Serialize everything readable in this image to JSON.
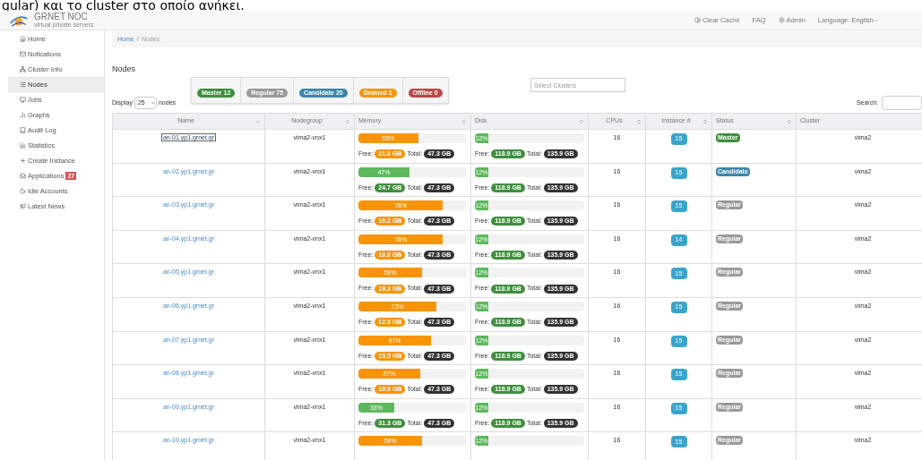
{
  "caption": "gular) και το cluster στο οποίο ανήκει.",
  "header": {
    "brand": "GRNET NOC",
    "tagline": "virtual private servers",
    "links": [
      {
        "kind": "cache",
        "label": "Clear Cache"
      },
      {
        "kind": "plain",
        "label": "FAQ"
      },
      {
        "kind": "admin",
        "label": "Admin"
      },
      {
        "kind": "dropdown",
        "label": "Language: English"
      }
    ]
  },
  "sidebar": {
    "items": [
      {
        "label": "Home",
        "selected": false
      },
      {
        "label": "Nofications",
        "selected": false
      },
      {
        "label": "Cluster Info",
        "selected": false
      },
      {
        "label": "Nodes",
        "selected": true
      },
      {
        "label": "Jobs",
        "selected": false
      },
      {
        "label": "Graphs",
        "selected": false
      },
      {
        "label": "Audit Log",
        "selected": false
      },
      {
        "label": "Statistics",
        "selected": false
      },
      {
        "label": "Create Instance",
        "selected": false
      },
      {
        "label": "Applications",
        "badge": "27",
        "selected": false
      },
      {
        "label": "Idle Accounts",
        "selected": false
      },
      {
        "label": "Latest News",
        "selected": false
      }
    ]
  },
  "breadcrumb": {
    "items": [
      "Home",
      "Nodes"
    ],
    "separator": "/"
  },
  "title": "Nodes",
  "filters": [
    {
      "label": "Master 12",
      "color": "#3e8f3e"
    },
    {
      "label": "Regular 75",
      "color": "#999999"
    },
    {
      "label": "Candidate 20",
      "color": "#3a87ad"
    },
    {
      "label": "Drained 1",
      "color": "#f89406"
    },
    {
      "label": "Offline 0",
      "color": "#b94a48"
    }
  ],
  "cluster_select": {
    "placeholder": "Select Clusters"
  },
  "display": {
    "before": "Display",
    "value": "25",
    "after": "nodes"
  },
  "search": {
    "label": "Search:"
  },
  "table": {
    "columns": [
      {
        "label": "Name",
        "sorted": true
      },
      {
        "label": "Nodegroup",
        "sorted": false
      },
      {
        "label": "Memory",
        "sorted": false
      },
      {
        "label": "Disk",
        "sorted": false
      },
      {
        "label": "CPUs",
        "sorted": false
      },
      {
        "label": "Instance #",
        "sorted": false
      },
      {
        "label": "Status",
        "sorted": false
      },
      {
        "label": "Cluster"
      }
    ],
    "rows": [
      {
        "name": "an-01.yp1.grnet.gr",
        "focused": true,
        "nodegroup": "vima2-vnx1",
        "memory": {
          "text": "55%",
          "level": 0.55,
          "color": "#f89406",
          "free_label": "Free:",
          "free": "21.0 GB",
          "total_label": "Total:",
          "total": "47.3 GB"
        },
        "disk": {
          "text": "12%",
          "level": 0.12,
          "free_label": "Free:",
          "free": "118.9 GB",
          "total_label": "Total:",
          "total": "135.9 GB"
        },
        "cpus": "16",
        "instances": "15",
        "status": {
          "label": "Master",
          "color": "#3e8f3e"
        },
        "cluster": "vima2"
      },
      {
        "name": "an-02.yp1.grnet.gr",
        "focused": false,
        "nodegroup": "vima2-vnx1",
        "memory": {
          "text": "47%",
          "level": 0.47,
          "color": "#5cb85c",
          "free_label": "Free:",
          "free": "24.7 GB",
          "total_label": "Total:",
          "total": "47.3 GB"
        },
        "disk": {
          "text": "12%",
          "level": 0.12,
          "free_label": "Free:",
          "free": "118.9 GB",
          "total_label": "Total:",
          "total": "135.9 GB"
        },
        "cpus": "16",
        "instances": "15",
        "status": {
          "label": "Candidate",
          "color": "#3a87ad"
        },
        "cluster": "vima2"
      },
      {
        "name": "an-03.yp1.grnet.gr",
        "focused": false,
        "nodegroup": "vima2-vnx1",
        "memory": {
          "text": "78%",
          "level": 0.78,
          "color": "#f89406",
          "free_label": "Free:",
          "free": "10.2 GB",
          "total_label": "Total:",
          "total": "47.3 GB"
        },
        "disk": {
          "text": "12%",
          "level": 0.12,
          "free_label": "Free:",
          "free": "118.9 GB",
          "total_label": "Total:",
          "total": "135.9 GB"
        },
        "cpus": "16",
        "instances": "15",
        "status": {
          "label": "Regular",
          "color": "#999999"
        },
        "cluster": "vima2"
      },
      {
        "name": "an-04.yp1.grnet.gr",
        "focused": false,
        "nodegroup": "vima2-vnx1",
        "memory": {
          "text": "78%",
          "level": 0.78,
          "color": "#f89406",
          "free_label": "Free:",
          "free": "10.0 GB",
          "total_label": "Total:",
          "total": "47.3 GB"
        },
        "disk": {
          "text": "12%",
          "level": 0.12,
          "free_label": "Free:",
          "free": "118.9 GB",
          "total_label": "Total:",
          "total": "135.9 GB"
        },
        "cpus": "16",
        "instances": "14",
        "status": {
          "label": "Regular",
          "color": "#999999"
        },
        "cluster": "vima2"
      },
      {
        "name": "an-05.yp1.grnet.gr",
        "focused": false,
        "nodegroup": "vima2-vnx1",
        "memory": {
          "text": "59%",
          "level": 0.59,
          "color": "#f89406",
          "free_label": "Free:",
          "free": "19.3 GB",
          "total_label": "Total:",
          "total": "47.3 GB"
        },
        "disk": {
          "text": "12%",
          "level": 0.12,
          "free_label": "Free:",
          "free": "118.9 GB",
          "total_label": "Total:",
          "total": "135.9 GB"
        },
        "cpus": "16",
        "instances": "15",
        "status": {
          "label": "Regular",
          "color": "#999999"
        },
        "cluster": "vima2"
      },
      {
        "name": "an-06.yp1.grnet.gr",
        "focused": false,
        "nodegroup": "vima2-vnx1",
        "memory": {
          "text": "72%",
          "level": 0.72,
          "color": "#f89406",
          "free_label": "Free:",
          "free": "12.9 GB",
          "total_label": "Total:",
          "total": "47.3 GB"
        },
        "disk": {
          "text": "12%",
          "level": 0.12,
          "free_label": "Free:",
          "free": "118.9 GB",
          "total_label": "Total:",
          "total": "135.9 GB"
        },
        "cpus": "16",
        "instances": "15",
        "status": {
          "label": "Regular",
          "color": "#999999"
        },
        "cluster": "vima2"
      },
      {
        "name": "an-07.yp1.grnet.gr",
        "focused": false,
        "nodegroup": "vima2-vnx1",
        "memory": {
          "text": "67%",
          "level": 0.67,
          "color": "#f89406",
          "free_label": "Free:",
          "free": "15.5 GB",
          "total_label": "Total:",
          "total": "47.3 GB"
        },
        "disk": {
          "text": "12%",
          "level": 0.12,
          "free_label": "Free:",
          "free": "118.9 GB",
          "total_label": "Total:",
          "total": "135.9 GB"
        },
        "cpus": "16",
        "instances": "15",
        "status": {
          "label": "Regular",
          "color": "#999999"
        },
        "cluster": "vima2"
      },
      {
        "name": "an-08.yp1.grnet.gr",
        "focused": false,
        "nodegroup": "vima2-vnx1",
        "memory": {
          "text": "57%",
          "level": 0.57,
          "color": "#f89406",
          "free_label": "Free:",
          "free": "19.9 GB",
          "total_label": "Total:",
          "total": "47.3 GB"
        },
        "disk": {
          "text": "12%",
          "level": 0.12,
          "free_label": "Free:",
          "free": "118.9 GB",
          "total_label": "Total:",
          "total": "135.9 GB"
        },
        "cpus": "16",
        "instances": "15",
        "status": {
          "label": "Regular",
          "color": "#999999"
        },
        "cluster": "vima2"
      },
      {
        "name": "an-09.yp1.grnet.gr",
        "focused": false,
        "nodegroup": "vima2-vnx1",
        "memory": {
          "text": "33%",
          "level": 0.33,
          "color": "#5cb85c",
          "free_label": "Free:",
          "free": "31.3 GB",
          "total_label": "Total:",
          "total": "47.3 GB"
        },
        "disk": {
          "text": "12%",
          "level": 0.12,
          "free_label": "Free:",
          "free": "118.9 GB",
          "total_label": "Total:",
          "total": "135.9 GB"
        },
        "cpus": "16",
        "instances": "15",
        "status": {
          "label": "Regular",
          "color": "#999999"
        },
        "cluster": "vima2"
      },
      {
        "name": "an-10.yp1.grnet.gr",
        "focused": false,
        "nodegroup": "vima2-vnx1",
        "memory": {
          "text": "59%",
          "level": 0.59,
          "color": "#f89406"
        },
        "disk": {
          "text": "12%",
          "level": 0.12
        },
        "cpus": "16",
        "instances": "15",
        "status": {
          "label": "Regular",
          "color": "#999999"
        },
        "cluster": "vima2"
      }
    ]
  }
}
